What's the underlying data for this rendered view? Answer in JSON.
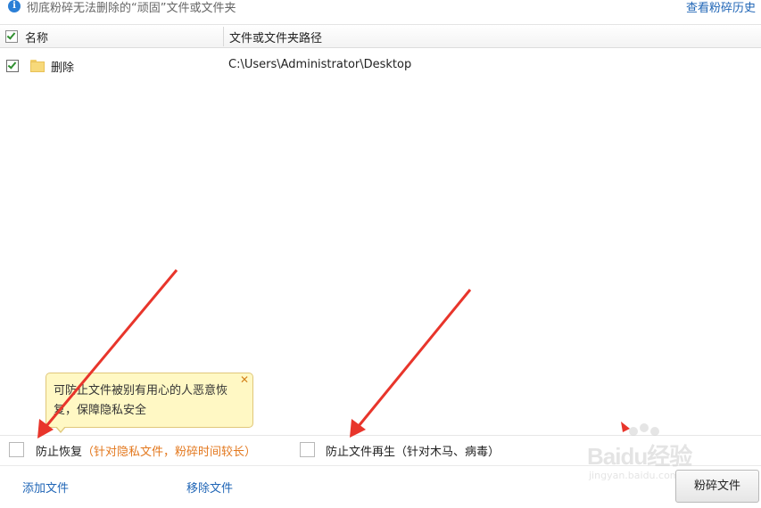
{
  "topbar": {
    "info_icon": "info-icon",
    "description": "彻底粉碎无法删除的“顽固”文件或文件夹",
    "history_link": "查看粉碎历史"
  },
  "table": {
    "columns": [
      "名称",
      "文件或文件夹路径"
    ],
    "header_checked": true,
    "rows": [
      {
        "checked": true,
        "icon": "folder-icon",
        "name": "删除",
        "path": "C:\\Users\\Administrator\\Desktop"
      }
    ]
  },
  "tooltip": {
    "text": "可防止文件被别有用心的人恶意恢复，保障隐私安全",
    "close_glyph": "✕"
  },
  "options": {
    "prevent_recovery": {
      "checked": false,
      "label": "防止恢复",
      "hint": "（针对隐私文件，粉碎时间较长）"
    },
    "prevent_regeneration": {
      "checked": false,
      "label": "防止文件再生（针对木马、病毒）"
    }
  },
  "bottom": {
    "add_file": "添加文件",
    "remove_file": "移除文件",
    "shred_button": "粉碎文件"
  },
  "watermark": {
    "main": "Baidu经验",
    "sub": "jingyan.baidu.com"
  },
  "colors": {
    "accent_link": "#1f65b6",
    "hint_orange": "#e3781e",
    "annotation_red": "#e8352b",
    "tooltip_bg": "#fff8c4"
  }
}
